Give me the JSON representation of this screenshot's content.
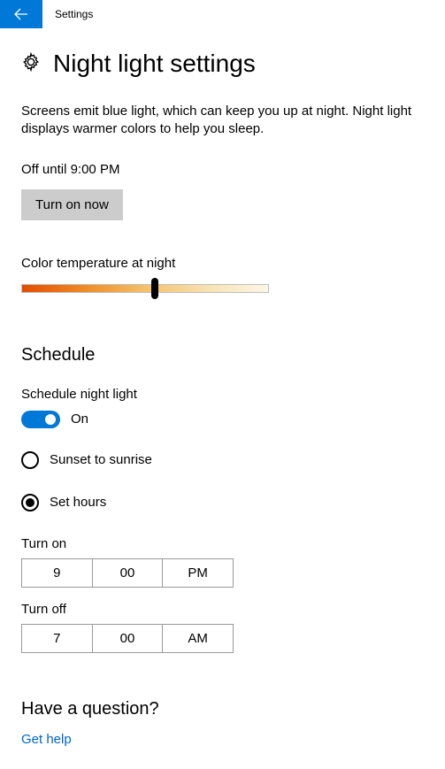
{
  "header": {
    "app_title": "Settings"
  },
  "page": {
    "title": "Night light settings",
    "description": "Screens emit blue light, which can keep you up at night. Night light displays warmer colors to help you sleep.",
    "status": "Off until 9:00 PM",
    "turn_on_button": "Turn on now",
    "color_temp_label": "Color temperature at night",
    "color_temp_value": 53
  },
  "schedule": {
    "heading": "Schedule",
    "schedule_label": "Schedule night light",
    "toggle_state": "On",
    "options": {
      "sunset": "Sunset to sunrise",
      "set_hours": "Set hours"
    },
    "selected_option": "set_hours",
    "turn_on": {
      "label": "Turn on",
      "hour": "9",
      "minute": "00",
      "ampm": "PM"
    },
    "turn_off": {
      "label": "Turn off",
      "hour": "7",
      "minute": "00",
      "ampm": "AM"
    }
  },
  "help": {
    "heading": "Have a question?",
    "link": "Get help"
  }
}
